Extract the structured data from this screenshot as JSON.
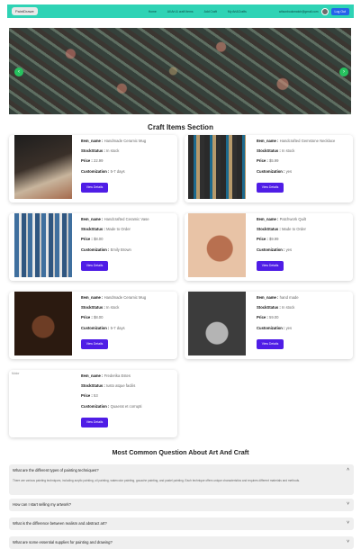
{
  "nav": {
    "brand": "PaintDrawe",
    "links": [
      "Home",
      "All Art & craft Items",
      "Add Craft",
      "My Art&Crafts"
    ],
    "email": "wilsonbookmatch@gmail.com",
    "logout": "Log Out"
  },
  "banner": {
    "prev": "‹",
    "next": "›"
  },
  "section_title": "Craft Items Section",
  "view_label": "View Details",
  "labels": {
    "name": "Item_name :",
    "stock": "StockStatus :",
    "price": "Price :",
    "custom": "Customization :"
  },
  "cards": [
    {
      "name": "Handmade Ceramic Mug",
      "stock": "In stock",
      "price": "22.99",
      "custom": "5-7 days"
    },
    {
      "name": "Handcrafted Gemstone Necklace",
      "stock": "In stock",
      "price": "$5.99",
      "custom": "yes"
    },
    {
      "name": "Handcrafted Ceramic Vase",
      "stock": "Made to Order",
      "price": "$8.00",
      "custom": "Emily Brown"
    },
    {
      "name": "Patchwork Quilt",
      "stock": "Made to Order",
      "price": "$9.99",
      "custom": "yes"
    },
    {
      "name": "Handmade Ceramic Mug",
      "stock": "In stock",
      "price": "$8.00",
      "custom": "5-7 days"
    },
    {
      "name": "hand made",
      "stock": "In stock",
      "price": "59.00",
      "custom": "yes"
    },
    {
      "name": "Frederika Estes",
      "stock": "Iusto atque facilis",
      "price": "53",
      "custom": "Quaerat et corrupti",
      "broken_alt": "Motor"
    }
  ],
  "faq_title": "Most Common Question About Art And Craft",
  "faqs": [
    {
      "q": "What are the different types of painting techniques?",
      "a": "There are various painting techniques, including acrylic painting, oil painting, watercolor painting, gouache painting, and pastel painting. Each technique offers unique characteristics and requires different materials and methods.",
      "open": true
    },
    {
      "q": "How can I start selling my artwork?",
      "open": false
    },
    {
      "q": "What is the difference between realism and abstract art?",
      "open": false
    },
    {
      "q": "What are some essential supplies for painting and drawing?",
      "open": false
    }
  ],
  "chevrons": {
    "up": "˄",
    "down": "˅"
  }
}
